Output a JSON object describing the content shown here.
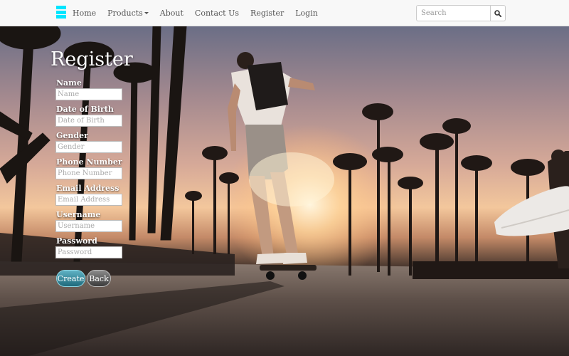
{
  "navbar": {
    "links": [
      "Home",
      "Products",
      "About",
      "Contact Us",
      "Register",
      "Login"
    ],
    "search": {
      "placeholder": "Search"
    },
    "brand_color": "#00e5ff"
  },
  "form": {
    "title": "Register",
    "fields": [
      {
        "label": "Name",
        "placeholder": "Name"
      },
      {
        "label": "Date of Birth",
        "placeholder": "Date of Birth"
      },
      {
        "label": "Gender",
        "placeholder": "Gender"
      },
      {
        "label": "Phone Number",
        "placeholder": "Phone Number"
      },
      {
        "label": "Email Address",
        "placeholder": "Email Address"
      },
      {
        "label": "Username",
        "placeholder": "Username"
      },
      {
        "label": "Password",
        "placeholder": "Password"
      }
    ],
    "create_label": "Create",
    "back_label": "Back"
  },
  "icons": {
    "brand": "hamburger-icon",
    "search": "search-icon",
    "products_caret": "caret-down-icon"
  }
}
